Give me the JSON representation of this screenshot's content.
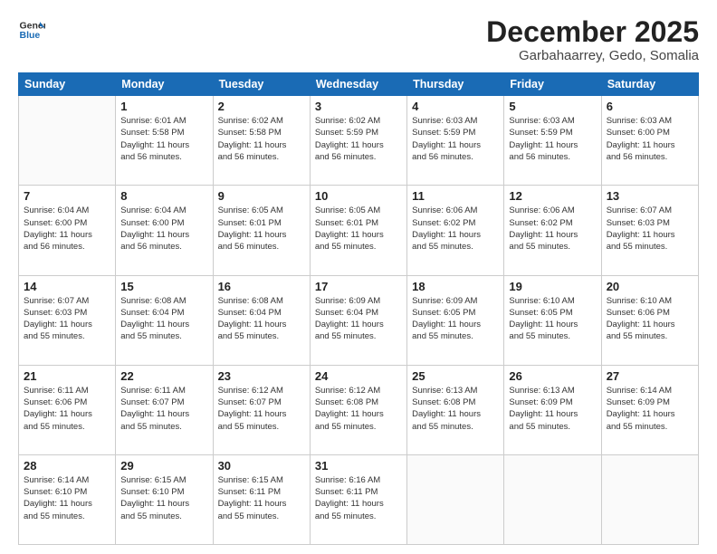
{
  "logo": {
    "line1": "General",
    "line2": "Blue"
  },
  "title": "December 2025",
  "subtitle": "Garbahaarrey, Gedo, Somalia",
  "weekdays": [
    "Sunday",
    "Monday",
    "Tuesday",
    "Wednesday",
    "Thursday",
    "Friday",
    "Saturday"
  ],
  "weeks": [
    [
      {
        "day": "",
        "info": ""
      },
      {
        "day": "1",
        "info": "Sunrise: 6:01 AM\nSunset: 5:58 PM\nDaylight: 11 hours\nand 56 minutes."
      },
      {
        "day": "2",
        "info": "Sunrise: 6:02 AM\nSunset: 5:58 PM\nDaylight: 11 hours\nand 56 minutes."
      },
      {
        "day": "3",
        "info": "Sunrise: 6:02 AM\nSunset: 5:59 PM\nDaylight: 11 hours\nand 56 minutes."
      },
      {
        "day": "4",
        "info": "Sunrise: 6:03 AM\nSunset: 5:59 PM\nDaylight: 11 hours\nand 56 minutes."
      },
      {
        "day": "5",
        "info": "Sunrise: 6:03 AM\nSunset: 5:59 PM\nDaylight: 11 hours\nand 56 minutes."
      },
      {
        "day": "6",
        "info": "Sunrise: 6:03 AM\nSunset: 6:00 PM\nDaylight: 11 hours\nand 56 minutes."
      }
    ],
    [
      {
        "day": "7",
        "info": "Sunrise: 6:04 AM\nSunset: 6:00 PM\nDaylight: 11 hours\nand 56 minutes."
      },
      {
        "day": "8",
        "info": "Sunrise: 6:04 AM\nSunset: 6:00 PM\nDaylight: 11 hours\nand 56 minutes."
      },
      {
        "day": "9",
        "info": "Sunrise: 6:05 AM\nSunset: 6:01 PM\nDaylight: 11 hours\nand 56 minutes."
      },
      {
        "day": "10",
        "info": "Sunrise: 6:05 AM\nSunset: 6:01 PM\nDaylight: 11 hours\nand 55 minutes."
      },
      {
        "day": "11",
        "info": "Sunrise: 6:06 AM\nSunset: 6:02 PM\nDaylight: 11 hours\nand 55 minutes."
      },
      {
        "day": "12",
        "info": "Sunrise: 6:06 AM\nSunset: 6:02 PM\nDaylight: 11 hours\nand 55 minutes."
      },
      {
        "day": "13",
        "info": "Sunrise: 6:07 AM\nSunset: 6:03 PM\nDaylight: 11 hours\nand 55 minutes."
      }
    ],
    [
      {
        "day": "14",
        "info": "Sunrise: 6:07 AM\nSunset: 6:03 PM\nDaylight: 11 hours\nand 55 minutes."
      },
      {
        "day": "15",
        "info": "Sunrise: 6:08 AM\nSunset: 6:04 PM\nDaylight: 11 hours\nand 55 minutes."
      },
      {
        "day": "16",
        "info": "Sunrise: 6:08 AM\nSunset: 6:04 PM\nDaylight: 11 hours\nand 55 minutes."
      },
      {
        "day": "17",
        "info": "Sunrise: 6:09 AM\nSunset: 6:04 PM\nDaylight: 11 hours\nand 55 minutes."
      },
      {
        "day": "18",
        "info": "Sunrise: 6:09 AM\nSunset: 6:05 PM\nDaylight: 11 hours\nand 55 minutes."
      },
      {
        "day": "19",
        "info": "Sunrise: 6:10 AM\nSunset: 6:05 PM\nDaylight: 11 hours\nand 55 minutes."
      },
      {
        "day": "20",
        "info": "Sunrise: 6:10 AM\nSunset: 6:06 PM\nDaylight: 11 hours\nand 55 minutes."
      }
    ],
    [
      {
        "day": "21",
        "info": "Sunrise: 6:11 AM\nSunset: 6:06 PM\nDaylight: 11 hours\nand 55 minutes."
      },
      {
        "day": "22",
        "info": "Sunrise: 6:11 AM\nSunset: 6:07 PM\nDaylight: 11 hours\nand 55 minutes."
      },
      {
        "day": "23",
        "info": "Sunrise: 6:12 AM\nSunset: 6:07 PM\nDaylight: 11 hours\nand 55 minutes."
      },
      {
        "day": "24",
        "info": "Sunrise: 6:12 AM\nSunset: 6:08 PM\nDaylight: 11 hours\nand 55 minutes."
      },
      {
        "day": "25",
        "info": "Sunrise: 6:13 AM\nSunset: 6:08 PM\nDaylight: 11 hours\nand 55 minutes."
      },
      {
        "day": "26",
        "info": "Sunrise: 6:13 AM\nSunset: 6:09 PM\nDaylight: 11 hours\nand 55 minutes."
      },
      {
        "day": "27",
        "info": "Sunrise: 6:14 AM\nSunset: 6:09 PM\nDaylight: 11 hours\nand 55 minutes."
      }
    ],
    [
      {
        "day": "28",
        "info": "Sunrise: 6:14 AM\nSunset: 6:10 PM\nDaylight: 11 hours\nand 55 minutes."
      },
      {
        "day": "29",
        "info": "Sunrise: 6:15 AM\nSunset: 6:10 PM\nDaylight: 11 hours\nand 55 minutes."
      },
      {
        "day": "30",
        "info": "Sunrise: 6:15 AM\nSunset: 6:11 PM\nDaylight: 11 hours\nand 55 minutes."
      },
      {
        "day": "31",
        "info": "Sunrise: 6:16 AM\nSunset: 6:11 PM\nDaylight: 11 hours\nand 55 minutes."
      },
      {
        "day": "",
        "info": ""
      },
      {
        "day": "",
        "info": ""
      },
      {
        "day": "",
        "info": ""
      }
    ]
  ]
}
